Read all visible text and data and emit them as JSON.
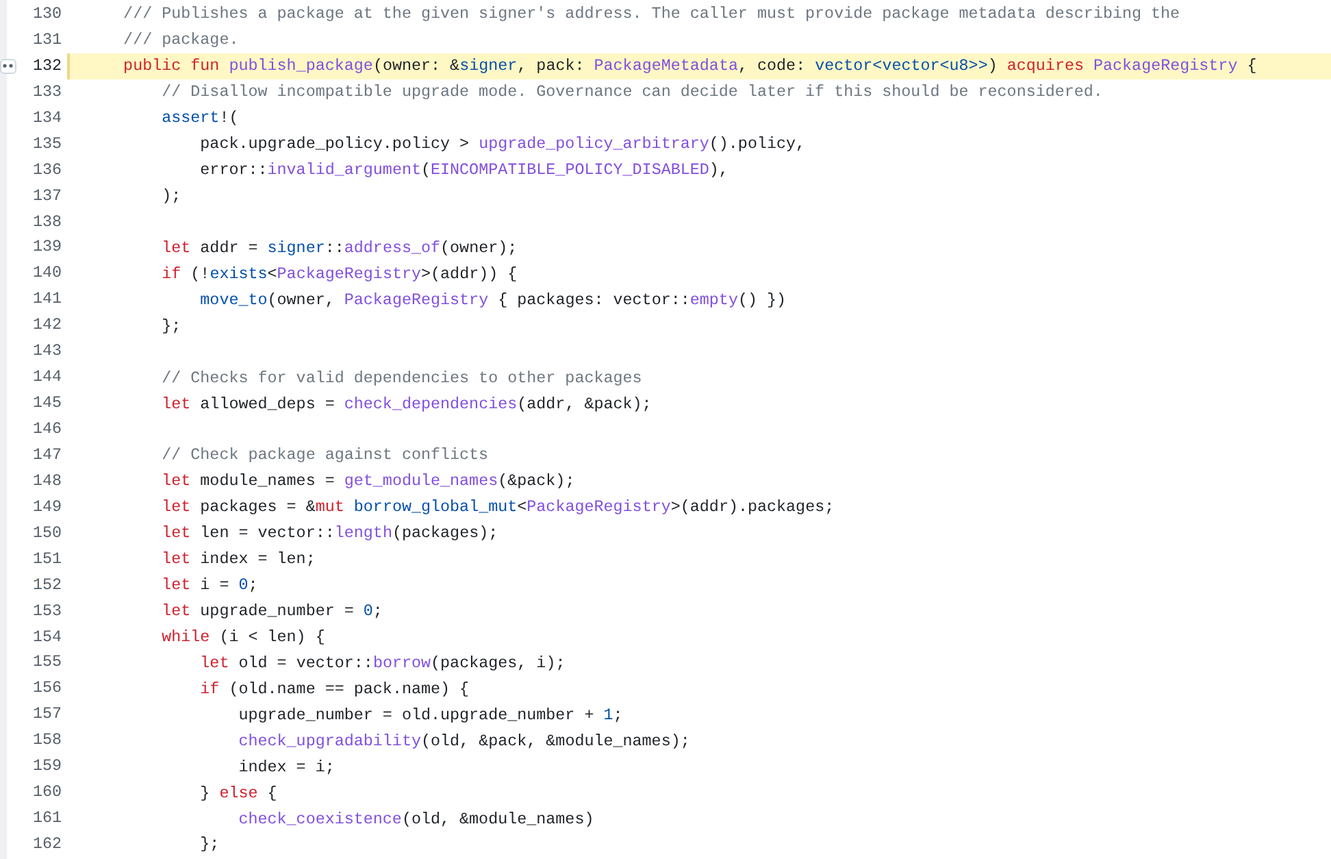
{
  "lines": [
    {
      "number": "130",
      "highlighted": false,
      "tokens": [
        {
          "kind": "comment",
          "text": "    /// Publishes a package at the given signer's address. The caller must provide package metadata describing the"
        }
      ]
    },
    {
      "number": "131",
      "highlighted": false,
      "tokens": [
        {
          "kind": "comment",
          "text": "    /// package."
        }
      ]
    },
    {
      "number": "132",
      "highlighted": true,
      "tokens": [
        {
          "kind": "keyword",
          "text": "    public fun "
        },
        {
          "kind": "function",
          "text": "publish_package"
        },
        {
          "kind": "plain",
          "text": "(owner: &"
        },
        {
          "kind": "builtin",
          "text": "signer"
        },
        {
          "kind": "plain",
          "text": ", pack: "
        },
        {
          "kind": "function",
          "text": "PackageMetadata"
        },
        {
          "kind": "plain",
          "text": ", code: "
        },
        {
          "kind": "builtin",
          "text": "vector<vector<u8>>"
        },
        {
          "kind": "plain",
          "text": ") "
        },
        {
          "kind": "keyword",
          "text": "acquires "
        },
        {
          "kind": "function",
          "text": "PackageRegistry"
        },
        {
          "kind": "plain",
          "text": " {"
        }
      ]
    },
    {
      "number": "133",
      "highlighted": false,
      "tokens": [
        {
          "kind": "comment",
          "text": "        // Disallow incompatible upgrade mode. Governance can decide later if this should be reconsidered."
        }
      ]
    },
    {
      "number": "134",
      "highlighted": false,
      "tokens": [
        {
          "kind": "builtin",
          "text": "        assert"
        },
        {
          "kind": "plain",
          "text": "!("
        }
      ]
    },
    {
      "number": "135",
      "highlighted": false,
      "tokens": [
        {
          "kind": "plain",
          "text": "            pack.upgrade_policy.policy > "
        },
        {
          "kind": "function",
          "text": "upgrade_policy_arbitrary"
        },
        {
          "kind": "plain",
          "text": "().policy,"
        }
      ]
    },
    {
      "number": "136",
      "highlighted": false,
      "tokens": [
        {
          "kind": "plain",
          "text": "            error::"
        },
        {
          "kind": "function",
          "text": "invalid_argument"
        },
        {
          "kind": "plain",
          "text": "("
        },
        {
          "kind": "function",
          "text": "EINCOMPATIBLE_POLICY_DISABLED"
        },
        {
          "kind": "plain",
          "text": "),"
        }
      ]
    },
    {
      "number": "137",
      "highlighted": false,
      "tokens": [
        {
          "kind": "plain",
          "text": "        );"
        }
      ]
    },
    {
      "number": "138",
      "highlighted": false
    },
    {
      "number": "139",
      "highlighted": false,
      "tokens": [
        {
          "kind": "keyword",
          "text": "        let"
        },
        {
          "kind": "plain",
          "text": " addr = "
        },
        {
          "kind": "builtin",
          "text": "signer"
        },
        {
          "kind": "plain",
          "text": "::"
        },
        {
          "kind": "function",
          "text": "address_of"
        },
        {
          "kind": "plain",
          "text": "(owner);"
        }
      ]
    },
    {
      "number": "140",
      "highlighted": false,
      "tokens": [
        {
          "kind": "keyword",
          "text": "        if"
        },
        {
          "kind": "plain",
          "text": " (!"
        },
        {
          "kind": "builtin",
          "text": "exists"
        },
        {
          "kind": "plain",
          "text": "<"
        },
        {
          "kind": "function",
          "text": "PackageRegistry"
        },
        {
          "kind": "plain",
          "text": ">(addr)) {"
        }
      ]
    },
    {
      "number": "141",
      "highlighted": false,
      "tokens": [
        {
          "kind": "builtin",
          "text": "            move_to"
        },
        {
          "kind": "plain",
          "text": "(owner, "
        },
        {
          "kind": "function",
          "text": "PackageRegistry"
        },
        {
          "kind": "plain",
          "text": " { packages: vector::"
        },
        {
          "kind": "function",
          "text": "empty"
        },
        {
          "kind": "plain",
          "text": "() })"
        }
      ]
    },
    {
      "number": "142",
      "highlighted": false,
      "tokens": [
        {
          "kind": "plain",
          "text": "        };"
        }
      ]
    },
    {
      "number": "143",
      "highlighted": false
    },
    {
      "number": "144",
      "highlighted": false,
      "tokens": [
        {
          "kind": "comment",
          "text": "        // Checks for valid dependencies to other packages"
        }
      ]
    },
    {
      "number": "145",
      "highlighted": false,
      "tokens": [
        {
          "kind": "keyword",
          "text": "        let"
        },
        {
          "kind": "plain",
          "text": " allowed_deps = "
        },
        {
          "kind": "function",
          "text": "check_dependencies"
        },
        {
          "kind": "plain",
          "text": "(addr, &pack);"
        }
      ]
    },
    {
      "number": "146",
      "highlighted": false
    },
    {
      "number": "147",
      "highlighted": false,
      "tokens": [
        {
          "kind": "comment",
          "text": "        // Check package against conflicts"
        }
      ]
    },
    {
      "number": "148",
      "highlighted": false,
      "tokens": [
        {
          "kind": "keyword",
          "text": "        let"
        },
        {
          "kind": "plain",
          "text": " module_names = "
        },
        {
          "kind": "function",
          "text": "get_module_names"
        },
        {
          "kind": "plain",
          "text": "(&pack);"
        }
      ]
    },
    {
      "number": "149",
      "highlighted": false,
      "tokens": [
        {
          "kind": "keyword",
          "text": "        let"
        },
        {
          "kind": "plain",
          "text": " packages = &"
        },
        {
          "kind": "keyword",
          "text": "mut "
        },
        {
          "kind": "builtin",
          "text": "borrow_global_mut"
        },
        {
          "kind": "plain",
          "text": "<"
        },
        {
          "kind": "function",
          "text": "PackageRegistry"
        },
        {
          "kind": "plain",
          "text": ">(addr).packages;"
        }
      ]
    },
    {
      "number": "150",
      "highlighted": false,
      "tokens": [
        {
          "kind": "keyword",
          "text": "        let"
        },
        {
          "kind": "plain",
          "text": " len = vector::"
        },
        {
          "kind": "function",
          "text": "length"
        },
        {
          "kind": "plain",
          "text": "(packages);"
        }
      ]
    },
    {
      "number": "151",
      "highlighted": false,
      "tokens": [
        {
          "kind": "keyword",
          "text": "        let"
        },
        {
          "kind": "plain",
          "text": " index = len;"
        }
      ]
    },
    {
      "number": "152",
      "highlighted": false,
      "tokens": [
        {
          "kind": "keyword",
          "text": "        let"
        },
        {
          "kind": "plain",
          "text": " i = "
        },
        {
          "kind": "builtin",
          "text": "0"
        },
        {
          "kind": "plain",
          "text": ";"
        }
      ]
    },
    {
      "number": "153",
      "highlighted": false,
      "tokens": [
        {
          "kind": "keyword",
          "text": "        let"
        },
        {
          "kind": "plain",
          "text": " upgrade_number = "
        },
        {
          "kind": "builtin",
          "text": "0"
        },
        {
          "kind": "plain",
          "text": ";"
        }
      ]
    },
    {
      "number": "154",
      "highlighted": false,
      "tokens": [
        {
          "kind": "keyword",
          "text": "        while"
        },
        {
          "kind": "plain",
          "text": " (i < len) {"
        }
      ]
    },
    {
      "number": "155",
      "highlighted": false,
      "tokens": [
        {
          "kind": "keyword",
          "text": "            let"
        },
        {
          "kind": "plain",
          "text": " old = vector::"
        },
        {
          "kind": "function",
          "text": "borrow"
        },
        {
          "kind": "plain",
          "text": "(packages, i);"
        }
      ]
    },
    {
      "number": "156",
      "highlighted": false,
      "tokens": [
        {
          "kind": "keyword",
          "text": "            if"
        },
        {
          "kind": "plain",
          "text": " (old.name == pack.name) {"
        }
      ]
    },
    {
      "number": "157",
      "highlighted": false,
      "tokens": [
        {
          "kind": "plain",
          "text": "                upgrade_number = old.upgrade_number + "
        },
        {
          "kind": "builtin",
          "text": "1"
        },
        {
          "kind": "plain",
          "text": ";"
        }
      ]
    },
    {
      "number": "158",
      "highlighted": false,
      "tokens": [
        {
          "kind": "function",
          "text": "                check_upgradability"
        },
        {
          "kind": "plain",
          "text": "(old, &pack, &module_names);"
        }
      ]
    },
    {
      "number": "159",
      "highlighted": false,
      "tokens": [
        {
          "kind": "plain",
          "text": "                index = i;"
        }
      ]
    },
    {
      "number": "160",
      "highlighted": false,
      "tokens": [
        {
          "kind": "plain",
          "text": "            } "
        },
        {
          "kind": "keyword",
          "text": "else"
        },
        {
          "kind": "plain",
          "text": " {"
        }
      ]
    },
    {
      "number": "161",
      "highlighted": false,
      "tokens": [
        {
          "kind": "function",
          "text": "                check_coexistence"
        },
        {
          "kind": "plain",
          "text": "(old, &module_names)"
        }
      ]
    },
    {
      "number": "162",
      "highlighted": false,
      "tokens": [
        {
          "kind": "plain",
          "text": "            };"
        }
      ]
    }
  ]
}
